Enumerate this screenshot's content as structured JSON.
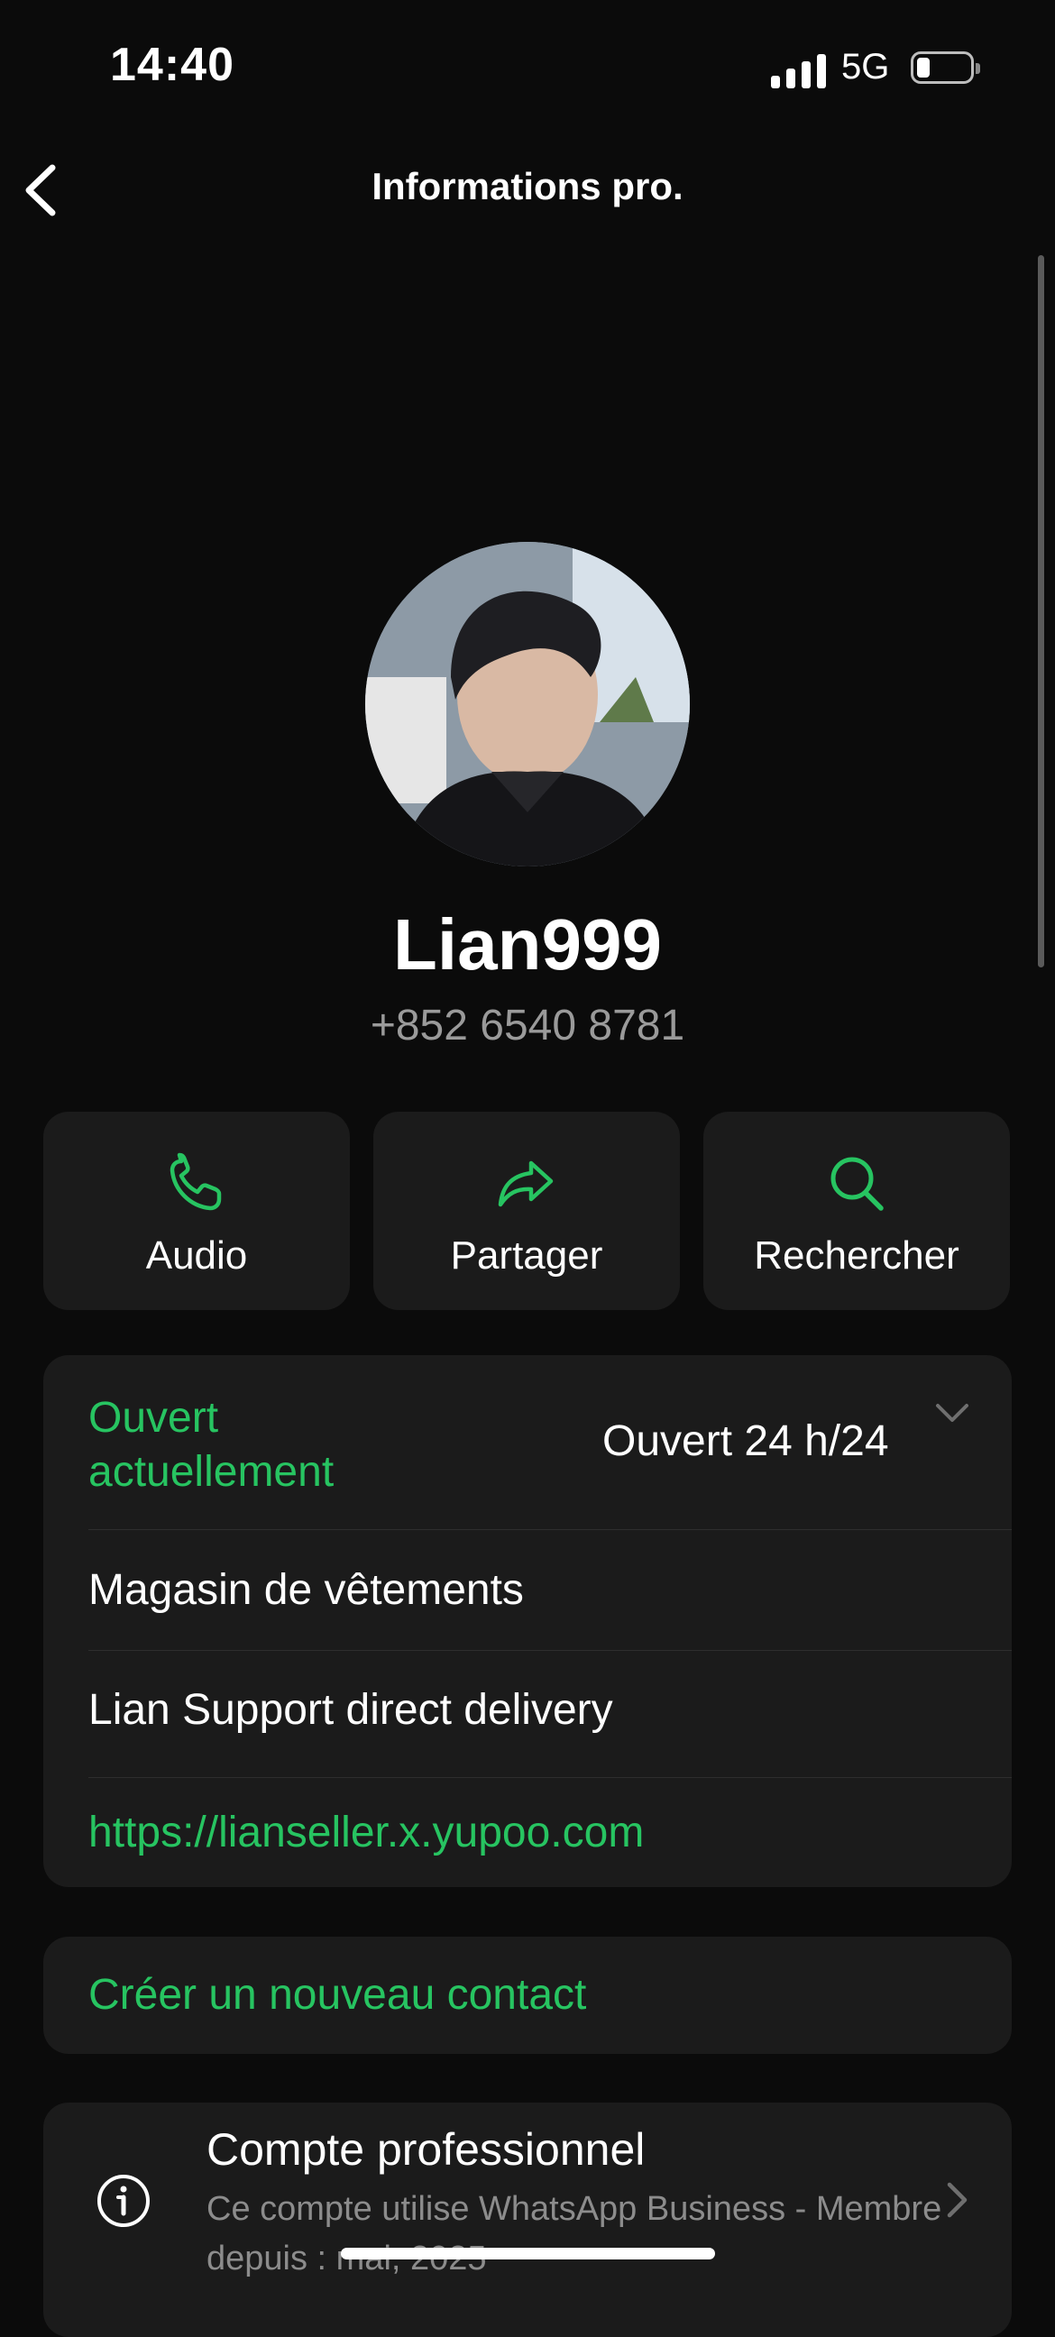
{
  "status_bar": {
    "time": "14:40",
    "network": "5G"
  },
  "nav": {
    "title": "Informations pro."
  },
  "profile": {
    "name": "Lian999",
    "phone": "+852 6540 8781"
  },
  "actions": [
    {
      "label": "Audio",
      "icon": "phone-icon"
    },
    {
      "label": "Partager",
      "icon": "share-icon"
    },
    {
      "label": "Rechercher",
      "icon": "search-icon"
    }
  ],
  "business": {
    "hours_status": "Ouvert actuellement",
    "hours_value": "Ouvert 24 h/24",
    "category": "Magasin de vêtements",
    "description": "Lian Support direct delivery",
    "website": "https://lianseller.x.yupoo.com"
  },
  "create_contact": "Créer un nouveau contact",
  "account": {
    "title": "Compte professionnel",
    "subtitle": "Ce compte utilise WhatsApp Business - Membre depuis : mai, 2025"
  },
  "colors": {
    "accent": "#27c461",
    "background": "#0b0b0b",
    "card": "#1b1b1b"
  }
}
